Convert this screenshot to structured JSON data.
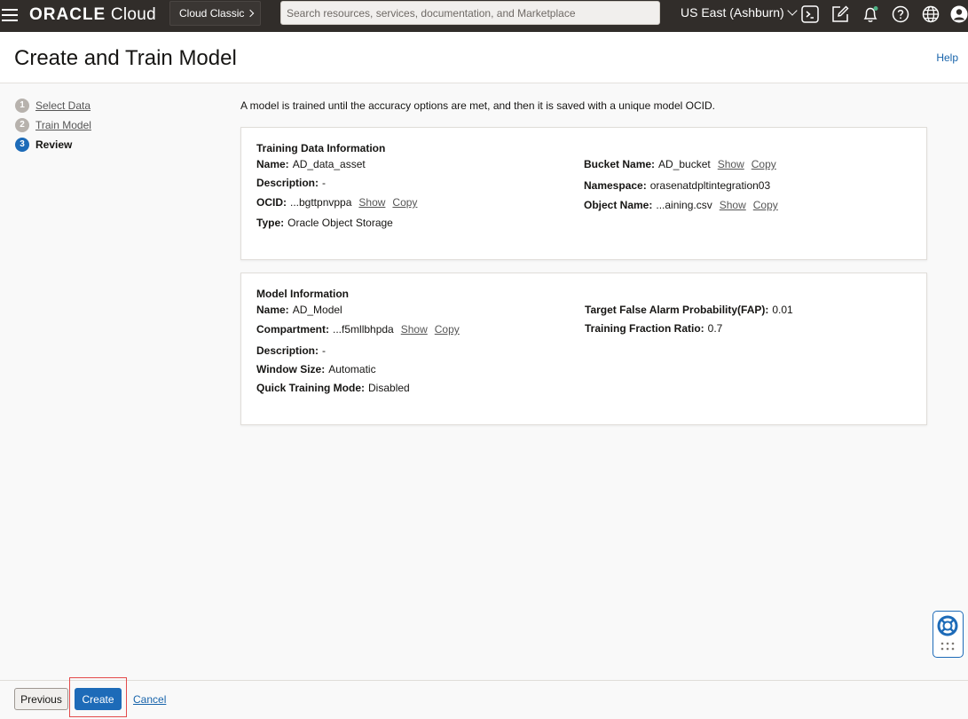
{
  "topbar": {
    "logo_bold": "ORACLE",
    "logo_light": " Cloud",
    "classic_label": "Cloud Classic",
    "search_placeholder": "Search resources, services, documentation, and Marketplace",
    "region_label": "US East (Ashburn)",
    "icons": [
      "cloud-shell-icon",
      "edit-icon",
      "bell-icon",
      "help-icon",
      "globe-icon",
      "user-icon"
    ]
  },
  "header": {
    "title": "Create and Train Model",
    "help": "Help"
  },
  "steps": [
    {
      "number": "1",
      "label": "Select Data",
      "state": "done"
    },
    {
      "number": "2",
      "label": "Train Model",
      "state": "done"
    },
    {
      "number": "3",
      "label": "Review",
      "state": "active"
    }
  ],
  "intro": "A model is trained until the accuracy options are met, and then it is saved with a unique model OCID.",
  "training_card": {
    "title": "Training Data Information",
    "name_key": "Name:",
    "name_val": "AD_data_asset",
    "desc_key": "Description:",
    "desc_val": "-",
    "ocid_key": "OCID:",
    "ocid_val": "...bgttpnvppa",
    "type_key": "Type:",
    "type_val": "Oracle Object Storage",
    "bucket_key": "Bucket Name:",
    "bucket_val": "AD_bucket",
    "ns_key": "Namespace:",
    "ns_val": "orasenatdpltintegration03",
    "obj_key": "Object Name:",
    "obj_val": "...aining.csv",
    "show": "Show",
    "copy": "Copy"
  },
  "model_card": {
    "title": "Model Information",
    "name_key": "Name:",
    "name_val": "AD_Model",
    "comp_key": "Compartment:",
    "comp_val": "...f5mllbhpda",
    "desc_key": "Description:",
    "desc_val": "-",
    "window_key": "Window Size:",
    "window_val": "Automatic",
    "quick_key": "Quick Training Mode:",
    "quick_val": "Disabled",
    "fap_key": "Target False Alarm Probability(FAP):",
    "fap_val": "0.01",
    "ratio_key": "Training Fraction Ratio:",
    "ratio_val": "0.7",
    "show": "Show",
    "copy": "Copy"
  },
  "footer": {
    "previous": "Previous",
    "create": "Create",
    "cancel": "Cancel"
  },
  "colors": {
    "topbar": "#312d2a",
    "primary": "#1d6bb8",
    "highlight": "#e34a4a"
  }
}
